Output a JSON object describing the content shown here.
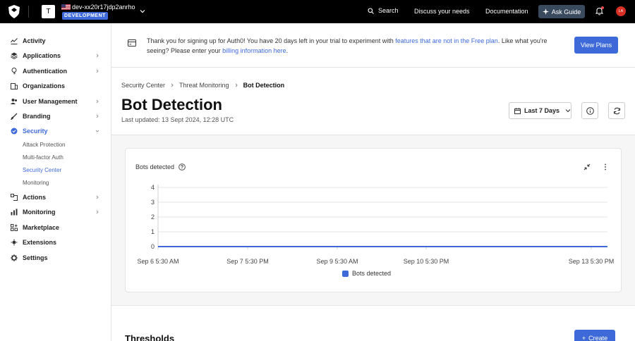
{
  "topbar": {
    "tenant_initial": "T",
    "tenant_name": "dev-xx20r17jdp2anrho",
    "tenant_env": "DEVELOPMENT",
    "search_label": "Search",
    "discuss_label": "Discuss your needs",
    "docs_label": "Documentation",
    "ask_guide_label": "Ask Guide",
    "user_initials": "LA"
  },
  "sidebar": {
    "items": [
      {
        "label": "Activity",
        "icon": "activity-icon"
      },
      {
        "label": "Applications",
        "icon": "applications-icon"
      },
      {
        "label": "Authentication",
        "icon": "authentication-icon"
      },
      {
        "label": "Organizations",
        "icon": "organizations-icon"
      },
      {
        "label": "User Management",
        "icon": "user-management-icon"
      },
      {
        "label": "Branding",
        "icon": "branding-icon"
      },
      {
        "label": "Security",
        "icon": "security-icon"
      },
      {
        "label": "Actions",
        "icon": "actions-icon"
      },
      {
        "label": "Monitoring",
        "icon": "monitoring-icon"
      },
      {
        "label": "Marketplace",
        "icon": "marketplace-icon"
      },
      {
        "label": "Extensions",
        "icon": "extensions-icon"
      },
      {
        "label": "Settings",
        "icon": "settings-icon"
      }
    ],
    "security_sub": [
      "Attack Protection",
      "Multi-factor Auth",
      "Security Center",
      "Monitoring"
    ]
  },
  "banner": {
    "text_1": "Thank you for signing up for Auth0! You have 20 days left in your trial to experiment with ",
    "link_1": "features that are not in the Free plan",
    "text_2": ". Like what you're seeing? Please enter your ",
    "link_2": "billing information here",
    "text_3": ".",
    "button_label": "View Plans"
  },
  "header": {
    "breadcrumb": [
      "Security Center",
      "Threat Monitoring",
      "Bot Detection"
    ],
    "title": "Bot Detection",
    "last_updated": "Last updated: 13 Sept 2024, 12:28 UTC",
    "range_label": "Last 7 Days"
  },
  "card": {
    "title": "Bots detected"
  },
  "chart_data": {
    "type": "line",
    "x": [
      "Sep 6 5:30 AM",
      "Sep 7 5:30 PM",
      "Sep 9 5:30 AM",
      "Sep 10 5:30 PM",
      "Sep 13 5:30 PM"
    ],
    "series": [
      {
        "name": "Bots detected",
        "values": [
          0,
          0,
          0,
          0,
          0
        ]
      }
    ],
    "yticks": [
      0,
      1,
      2,
      3,
      4
    ],
    "ylim": [
      0,
      4
    ],
    "grid": true,
    "legend": "bottom",
    "color": "#3e6ad9"
  },
  "thresholds": {
    "title": "Thresholds",
    "create_label": "Create"
  }
}
